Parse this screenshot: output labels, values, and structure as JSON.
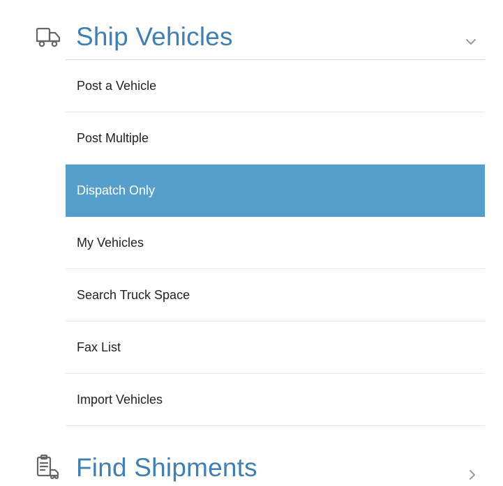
{
  "sections": {
    "ship": {
      "title": "Ship Vehicles",
      "icon": "truck-icon",
      "expanded": true,
      "items": [
        {
          "label": "Post a Vehicle",
          "active": false
        },
        {
          "label": "Post Multiple",
          "active": false
        },
        {
          "label": "Dispatch Only",
          "active": true
        },
        {
          "label": "My Vehicles",
          "active": false
        },
        {
          "label": "Search Truck Space",
          "active": false
        },
        {
          "label": "Fax List",
          "active": false
        },
        {
          "label": "Import Vehicles",
          "active": false
        }
      ]
    },
    "find": {
      "title": "Find Shipments",
      "icon": "clipboard-truck-icon",
      "expanded": false
    }
  },
  "colors": {
    "accent": "#3f7fb3",
    "active_bg": "#569fcb",
    "active_text": "#ffffff",
    "divider": "#e8e8e8"
  }
}
